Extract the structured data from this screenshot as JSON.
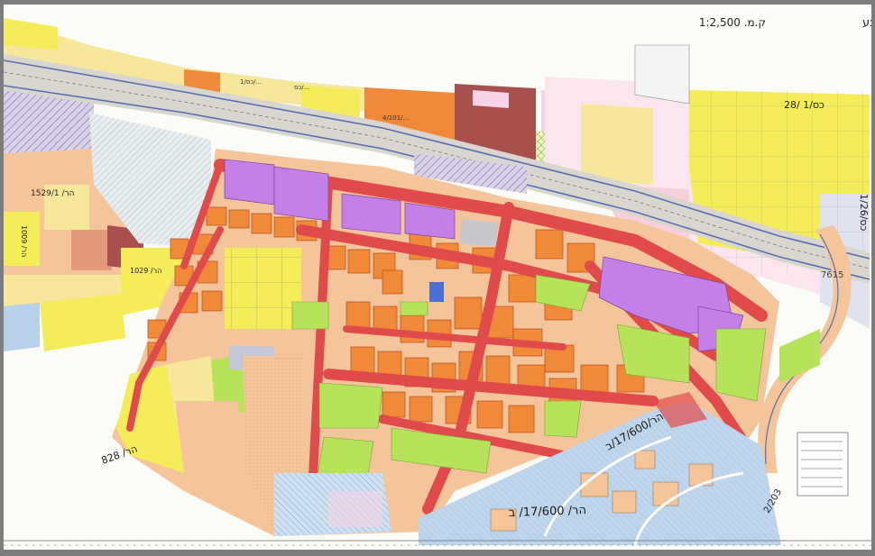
{
  "sheet": {
    "title": "מצב מוצע",
    "scale_label": "ק.מ. 1:2,500"
  },
  "plan_labels": {
    "bottom_plan": "הר/ 17/600/ ב",
    "diagonal_plan": "הר/17/600/ב",
    "ne_plan": "28/ כס/1",
    "east_plan": "כס/1/26",
    "west_plan": "הר/ 1529/1",
    "nw_plan_1": "הר/ 1029",
    "nw_plan_2": "הר/ 1009",
    "sw_plan": "הר/ 828",
    "parcel_7615": "7615",
    "road_number": "2/203",
    "north_plan_1": "כס/1/...",
    "north_plan_2": "כס/...",
    "north_plan_3": "4/101/..."
  },
  "colors": {
    "residential_yellow": "#f5ec5a",
    "residential_light": "#f7e79a",
    "residential_orange": "#f08a38",
    "commercial_red": "#e83a3a",
    "road_red": "#e14a4a",
    "employment_purple": "#c580e8",
    "open_green": "#b7e35b",
    "public_brown": "#a8504d",
    "agricultural_peach": "#f4c49a",
    "existing_blue": "#b7d1ea",
    "rail_grey": "#c7c7c7",
    "hatch_pink": "#f6d3e6"
  }
}
